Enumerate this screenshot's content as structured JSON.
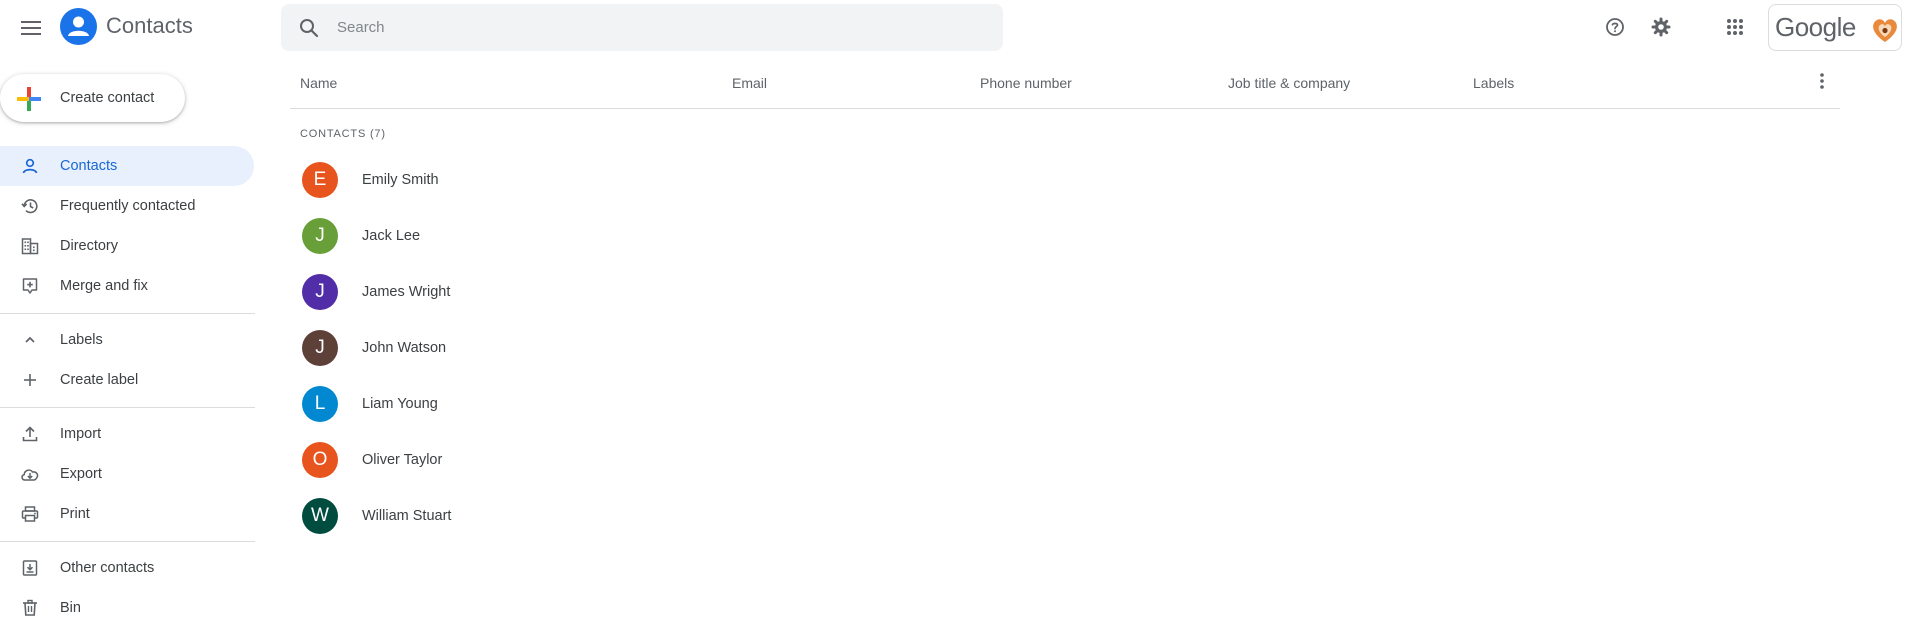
{
  "app": {
    "title": "Contacts",
    "logo_icon": "person-circle-icon",
    "accent_color": "#1a73e8"
  },
  "search": {
    "placeholder": "Search"
  },
  "header": {
    "help_icon": "help-icon",
    "settings_icon": "gear-icon",
    "apps_icon": "apps-grid-icon",
    "account_brand": "Google"
  },
  "sidebar": {
    "create_label": "Create contact",
    "items": [
      {
        "label": "Contacts",
        "icon": "person-icon",
        "active": true
      },
      {
        "label": "Frequently contacted",
        "icon": "history-icon"
      },
      {
        "label": "Directory",
        "icon": "building-icon"
      },
      {
        "label": "Merge and fix",
        "icon": "merge-icon"
      },
      {
        "label": "Labels",
        "icon": "chevron-up-icon"
      },
      {
        "label": "Create label",
        "icon": "plus-icon"
      },
      {
        "label": "Import",
        "icon": "upload-icon"
      },
      {
        "label": "Export",
        "icon": "cloud-download-icon"
      },
      {
        "label": "Print",
        "icon": "printer-icon"
      },
      {
        "label": "Other contacts",
        "icon": "archive-download-icon"
      },
      {
        "label": "Bin",
        "icon": "trash-icon"
      }
    ],
    "active_color": "#e8f0fe"
  },
  "table": {
    "columns": [
      "Name",
      "Email",
      "Phone number",
      "Job title & company",
      "Labels"
    ],
    "section_title": "CONTACTS (7)",
    "contacts": [
      {
        "initial": "E",
        "name": "Emily Smith",
        "color": "#e8541e"
      },
      {
        "initial": "J",
        "name": "Jack Lee",
        "color": "#689f38"
      },
      {
        "initial": "J",
        "name": "James Wright",
        "color": "#512da8"
      },
      {
        "initial": "J",
        "name": "John Watson",
        "color": "#5d4037"
      },
      {
        "initial": "L",
        "name": "Liam Young",
        "color": "#0288d1"
      },
      {
        "initial": "O",
        "name": "Oliver Taylor",
        "color": "#e8541e"
      },
      {
        "initial": "W",
        "name": "William Stuart",
        "color": "#004d40"
      }
    ]
  }
}
